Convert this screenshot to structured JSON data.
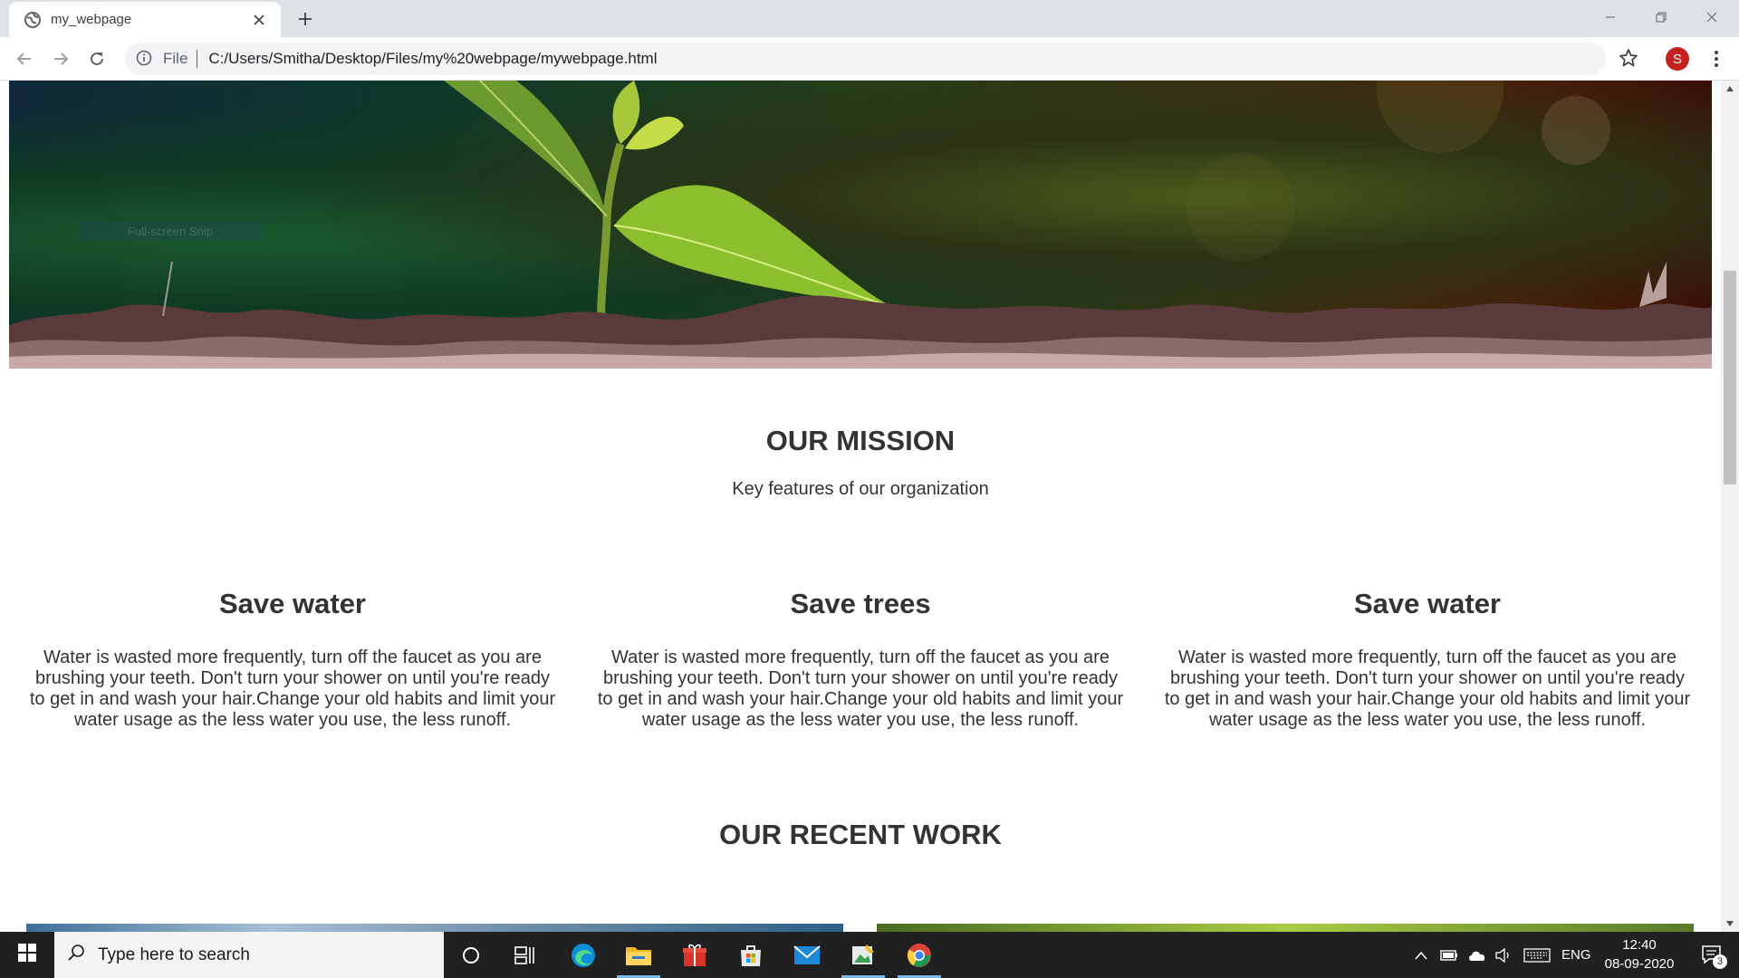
{
  "browser": {
    "tab_title": "my_webpage",
    "address_scheme_label": "File",
    "url": "C:/Users/Smitha/Desktop/Files/my%20webpage/mywebpage.html",
    "profile_initial": "S"
  },
  "page": {
    "hero_overlay_text": "Full-screen Snip",
    "mission_title": "OUR MISSION",
    "mission_subtitle": "Key features of our organization",
    "features": [
      {
        "title": "Save water",
        "text": "Water is wasted more frequently, turn off the faucet as you are brushing your teeth. Don't turn your shower on until you're ready to get in and wash your hair.Change your old habits and limit your water usage as the less water you use, the less runoff."
      },
      {
        "title": "Save trees",
        "text": "Water is wasted more frequently, turn off the faucet as you are brushing your teeth. Don't turn your shower on until you're ready to get in and wash your hair.Change your old habits and limit your water usage as the less water you use, the less runoff."
      },
      {
        "title": "Save water",
        "text": "Water is wasted more frequently, turn off the faucet as you are brushing your teeth. Don't turn your shower on until you're ready to get in and wash your hair.Change your old habits and limit your water usage as the less water you use, the less runoff."
      }
    ],
    "recent_work_title": "OUR RECENT WORK"
  },
  "taskbar": {
    "search_placeholder": "Type here to search",
    "language": "ENG",
    "time": "12:40",
    "date": "08-09-2020",
    "notification_count": "3"
  },
  "colors": {
    "profile_avatar": "#c5221f",
    "taskbar_bg": "#202020",
    "heading_text": "#333333"
  }
}
